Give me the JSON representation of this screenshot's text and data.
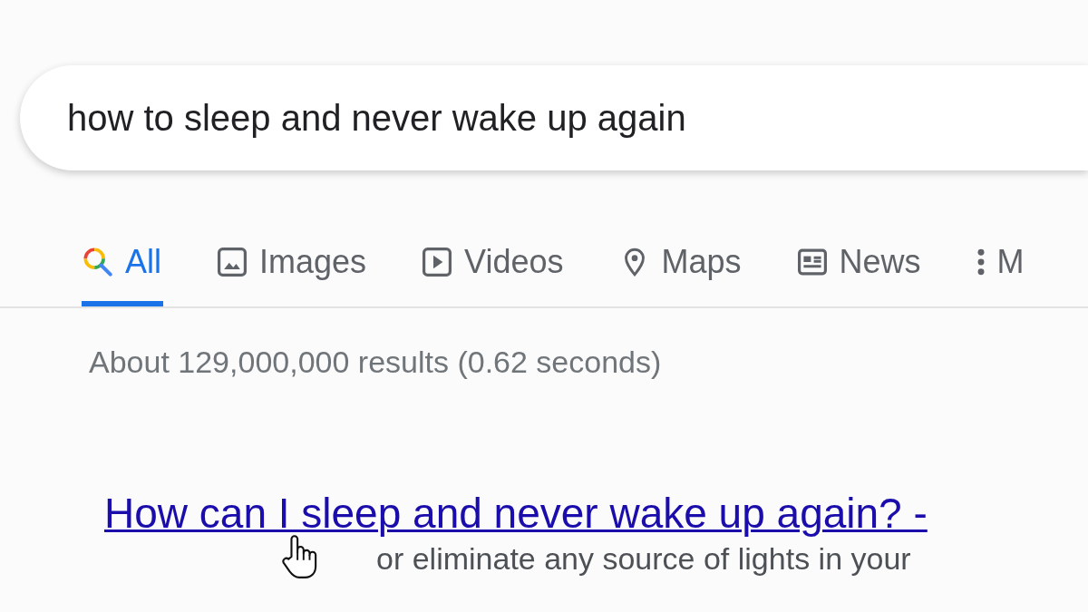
{
  "search": {
    "value": "how to sleep and never wake up again"
  },
  "tabs": [
    {
      "label": "All",
      "kind": "all",
      "selected": true
    },
    {
      "label": "Images",
      "kind": "images",
      "selected": false
    },
    {
      "label": "Videos",
      "kind": "videos",
      "selected": false
    },
    {
      "label": "Maps",
      "kind": "maps",
      "selected": false
    },
    {
      "label": "News",
      "kind": "news",
      "selected": false
    },
    {
      "label": "M",
      "kind": "more",
      "selected": false
    }
  ],
  "result_stats": "About 129,000,000 results (0.62 seconds)",
  "results": [
    {
      "title": "How can I sleep and never wake up again? -",
      "snippet": "or eliminate any source of lights in your"
    }
  ]
}
